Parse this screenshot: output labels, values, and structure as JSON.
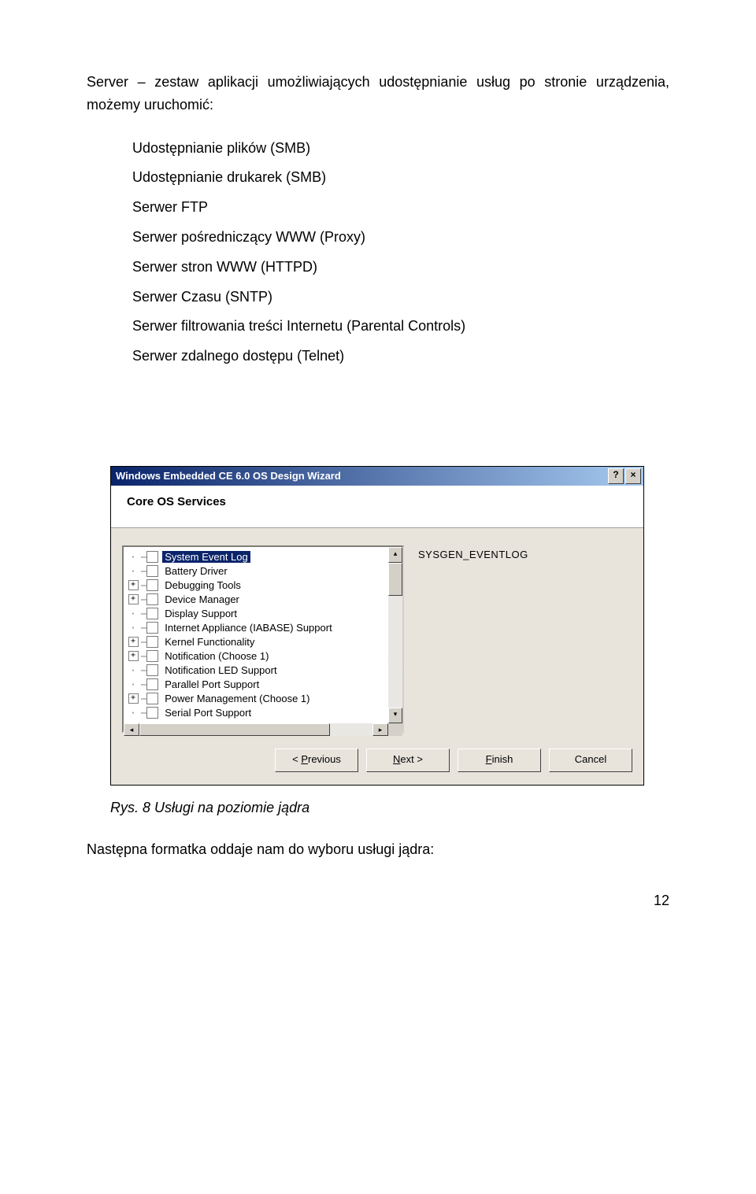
{
  "intro": "Server – zestaw aplikacji umożliwiających udostępnianie usług po stronie urządzenia, możemy uruchomić:",
  "list": [
    "Udostępnianie plików (SMB)",
    "Udostępnianie drukarek (SMB)",
    "Serwer FTP",
    "Serwer pośredniczący WWW (Proxy)",
    "Serwer stron WWW (HTTPD)",
    "Serwer Czasu (SNTP)",
    "Serwer filtrowania treści Internetu (Parental Controls)",
    "Serwer zdalnego dostępu (Telnet)"
  ],
  "dialog": {
    "title": "Windows Embedded CE 6.0 OS Design Wizard",
    "help_btn": "?",
    "close_btn": "×",
    "heading": "Core OS Services",
    "right_text": "SYSGEN_EVENTLOG",
    "tree": [
      {
        "expander": "",
        "label": "System Event Log",
        "selected": true
      },
      {
        "expander": "",
        "label": "Battery Driver",
        "selected": false
      },
      {
        "expander": "+",
        "label": "Debugging Tools",
        "selected": false
      },
      {
        "expander": "+",
        "label": "Device Manager",
        "selected": false
      },
      {
        "expander": "",
        "label": "Display Support",
        "selected": false
      },
      {
        "expander": "",
        "label": "Internet Appliance (IABASE) Support",
        "selected": false
      },
      {
        "expander": "+",
        "label": "Kernel Functionality",
        "selected": false
      },
      {
        "expander": "+",
        "label": "Notification (Choose 1)",
        "selected": false
      },
      {
        "expander": "",
        "label": "Notification LED Support",
        "selected": false
      },
      {
        "expander": "",
        "label": "Parallel Port Support",
        "selected": false
      },
      {
        "expander": "+",
        "label": "Power Management (Choose 1)",
        "selected": false
      },
      {
        "expander": "",
        "label": "Serial Port Support",
        "selected": false
      }
    ],
    "buttons": {
      "previous": {
        "pre": "< ",
        "u": "P",
        "rest": "revious"
      },
      "next": {
        "pre": "",
        "u": "N",
        "rest": "ext >"
      },
      "finish": {
        "pre": "",
        "u": "F",
        "rest": "inish"
      },
      "cancel": {
        "pre": "",
        "u": "",
        "rest": "Cancel"
      }
    }
  },
  "caption": "Rys. 8 Usługi na poziomie jądra",
  "closing": "Następna formatka oddaje nam do wyboru usługi jądra:",
  "page_number": "12"
}
